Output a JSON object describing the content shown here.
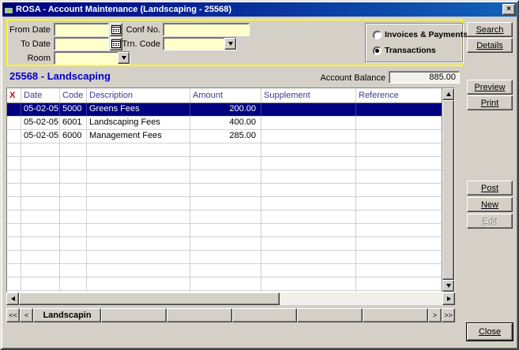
{
  "window": {
    "title": "ROSA - Account Maintenance (Landscaping - 25568)",
    "close_glyph": "×"
  },
  "filters": {
    "from_date": {
      "label": "From Date",
      "value": ""
    },
    "to_date": {
      "label": "To Date",
      "value": ""
    },
    "room": {
      "label": "Room",
      "value": ""
    },
    "conf_no": {
      "label": "Conf No.",
      "value": ""
    },
    "trn_code": {
      "label": "Trn. Code",
      "value": ""
    },
    "view_options": {
      "invoices_payments": "Invoices & Payments",
      "transactions": "Transactions",
      "selected": "Transactions",
      "selected_index": 1
    }
  },
  "account": {
    "heading": "25568 - Landscaping",
    "balance_label": "Account Balance",
    "balance": "885.00"
  },
  "side_buttons": {
    "search": "Search",
    "details": "Details",
    "preview": "Preview",
    "print": "Print",
    "post": "Post",
    "new": "New",
    "edit": "Edit",
    "close": "Close"
  },
  "table": {
    "headers": {
      "delete": "X",
      "date": "Date",
      "code": "Code",
      "description": "Description",
      "amount": "Amount",
      "supplement": "Supplement",
      "reference": "Reference"
    },
    "rows": [
      {
        "date": "05-02-05",
        "code": "5000",
        "description": "Greens Fees",
        "amount": "200.00",
        "supplement": "",
        "reference": "",
        "selected": true
      },
      {
        "date": "05-02-05",
        "code": "6001",
        "description": "Landscaping Fees",
        "amount": "400.00",
        "supplement": "",
        "reference": "",
        "selected": false
      },
      {
        "date": "05-02-05",
        "code": "6000",
        "description": "Management Fees",
        "amount": "285.00",
        "supplement": "",
        "reference": "",
        "selected": false
      }
    ],
    "empty_row_count": 12
  },
  "pager": {
    "first": "<<",
    "prev": "<",
    "active_tab": "Landscapin",
    "empty_cells": 5,
    "next": ">",
    "last": ">>"
  },
  "colors": {
    "titlebar": "#000080",
    "field_bg": "#ffffcc",
    "panel_border": "#ffff00",
    "selected_row_bg": "#000080",
    "selected_row_fg": "#ffffff",
    "column_header_text": "#3b3b8f",
    "delete_header_text": "#cc0000",
    "account_heading_text": "#0000cc"
  }
}
